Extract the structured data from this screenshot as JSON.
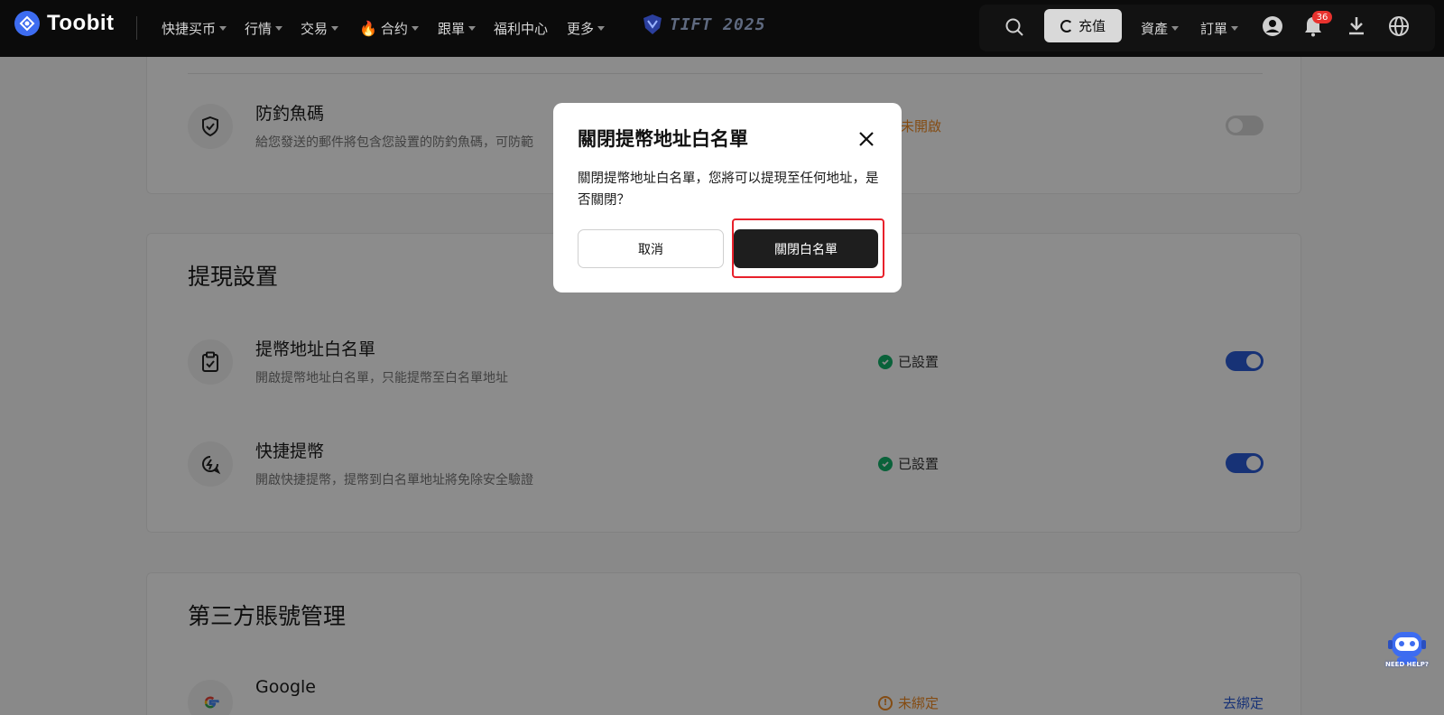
{
  "header": {
    "brand": "Toobit",
    "nav": [
      {
        "label": "快捷买币",
        "caret": true
      },
      {
        "label": "行情",
        "caret": true
      },
      {
        "label": "交易",
        "caret": true
      },
      {
        "label": "合约",
        "caret": true,
        "icon": "flame-icon"
      },
      {
        "label": "跟單",
        "caret": true
      },
      {
        "label": "福利中心",
        "caret": false
      },
      {
        "label": "更多",
        "caret": true
      }
    ],
    "event_logo": "TIFT 2025",
    "deposit_label": "充值",
    "assets_label": "資產",
    "orders_label": "訂單",
    "notification_count": "36",
    "icons": [
      "search-icon",
      "user-icon",
      "bell-icon",
      "download-icon",
      "globe-icon"
    ]
  },
  "anti_phishing": {
    "title": "防釣魚碼",
    "desc": "給您發送的郵件將包含您設置的防釣魚碼，可防範",
    "status": "未開啟",
    "enabled": false
  },
  "withdraw_settings": {
    "title": "提現設置",
    "rows": [
      {
        "title": "提幣地址白名單",
        "desc": "開啟提幣地址白名單，只能提幣至白名單地址",
        "status": "已設置",
        "enabled": true
      },
      {
        "title": "快捷提幣",
        "desc": "開啟快捷提幣，提幣到白名單地址將免除安全驗證",
        "status": "已設置",
        "enabled": true
      }
    ]
  },
  "third_party": {
    "title": "第三方賬號管理",
    "rows": [
      {
        "title": "Google",
        "status": "未綁定",
        "action": "去綁定"
      }
    ]
  },
  "modal": {
    "title": "關閉提幣地址白名單",
    "body": "關閉提幣地址白名單，您將可以提現至任何地址，是否關閉？",
    "cancel_label": "取消",
    "confirm_label": "關閉白名單"
  },
  "helper": {
    "label": "NEED HELP?"
  },
  "colors": {
    "accent_blue": "#2a5bd7",
    "success_green": "#13b26b",
    "warning_orange": "#f08a24",
    "highlight_red": "#e8212b",
    "header_bg": "#0b0b0b"
  }
}
